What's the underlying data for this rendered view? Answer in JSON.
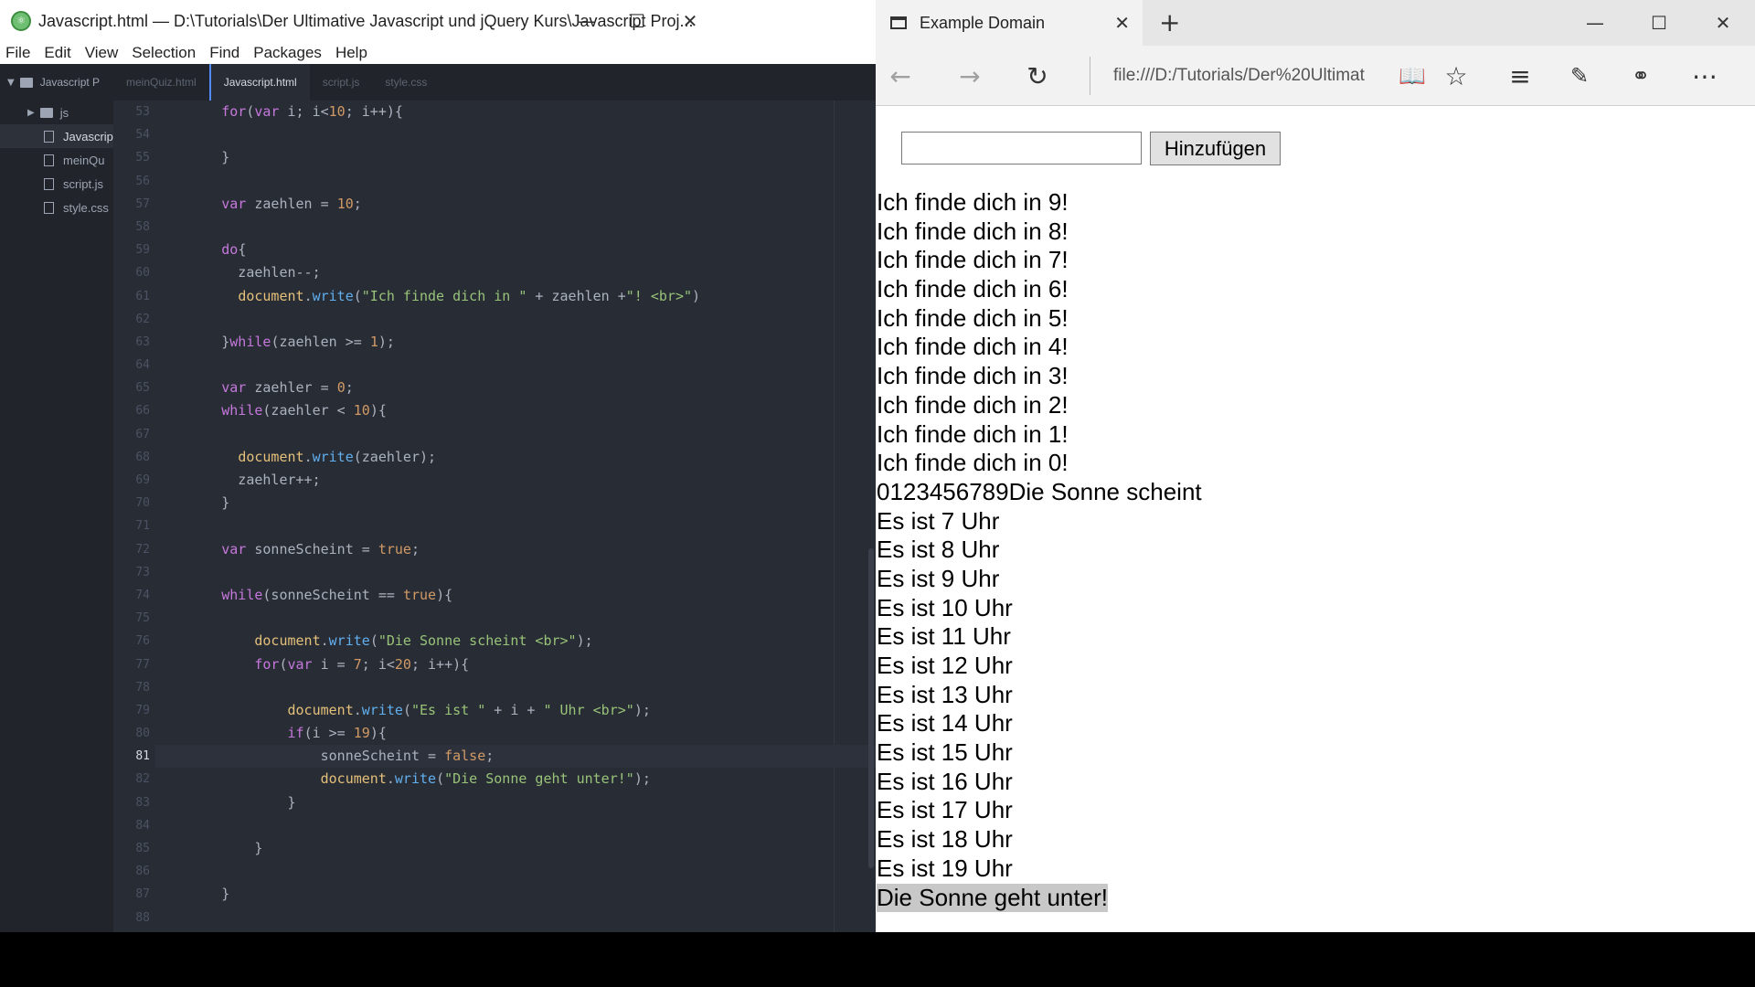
{
  "editor": {
    "title": "Javascript.html — D:\\Tutorials\\Der Ultimative Javascript und jQuery Kurs\\Javascript Proj...",
    "menu": [
      "File",
      "Edit",
      "View",
      "Selection",
      "Find",
      "Packages",
      "Help"
    ],
    "tree": {
      "root": "Javascript P",
      "items": [
        {
          "label": "js",
          "type": "folder"
        },
        {
          "label": "Javascrip",
          "type": "file"
        },
        {
          "label": "meinQu",
          "type": "file"
        },
        {
          "label": "script.js",
          "type": "file"
        },
        {
          "label": "style.css",
          "type": "file"
        }
      ]
    },
    "tabs": [
      "meinQuiz.html",
      "Javascript.html",
      "script.js",
      "style.css"
    ],
    "active_tab": "Javascript.html",
    "current_line": 81,
    "line_numbers": [
      "53",
      "54",
      "55",
      "56",
      "57",
      "58",
      "59",
      "60",
      "61",
      "62",
      "63",
      "64",
      "65",
      "66",
      "67",
      "68",
      "69",
      "70",
      "71",
      "72",
      "73",
      "74",
      "75",
      "76",
      "77",
      "78",
      "79",
      "80",
      "81",
      "82",
      "83",
      "84",
      "85",
      "86",
      "87",
      "88"
    ],
    "code_lines": [
      "        for(var i; i<10; i++){",
      "",
      "        }",
      "",
      "        var zaehlen = 10;",
      "",
      "        do{",
      "          zaehlen--;",
      "          document.write(\"Ich finde dich in \" + zaehlen +\"! <br>\")",
      "",
      "        }while(zaehlen >= 1);",
      "",
      "        var zaehler = 0;",
      "        while(zaehler < 10){",
      "",
      "          document.write(zaehler);",
      "          zaehler++;",
      "        }",
      "",
      "        var sonneScheint = true;",
      "",
      "        while(sonneScheint == true){",
      "",
      "            document.write(\"Die Sonne scheint <br>\");",
      "            for(var i = 7; i<20; i++){",
      "",
      "                document.write(\"Es ist \" + i + \" Uhr <br>\");",
      "                if(i >= 19){",
      "                    sonneScheint = false;",
      "                    document.write(\"Die Sonne geht unter!\");",
      "                }",
      "",
      "            }",
      "",
      "        }",
      ""
    ]
  },
  "browser": {
    "tab_title": "Example Domain",
    "address": "file:///D:/Tutorials/Der%20Ultimat",
    "input_value": "",
    "button_label": "Hinzufügen",
    "output_lines": [
      "Ich finde dich in 9!",
      "Ich finde dich in 8!",
      "Ich finde dich in 7!",
      "Ich finde dich in 6!",
      "Ich finde dich in 5!",
      "Ich finde dich in 4!",
      "Ich finde dich in 3!",
      "Ich finde dich in 2!",
      "Ich finde dich in 1!",
      "Ich finde dich in 0!",
      "0123456789Die Sonne scheint",
      "Es ist 7 Uhr",
      "Es ist 8 Uhr",
      "Es ist 9 Uhr",
      "Es ist 10 Uhr",
      "Es ist 11 Uhr",
      "Es ist 12 Uhr",
      "Es ist 13 Uhr",
      "Es ist 14 Uhr",
      "Es ist 15 Uhr",
      "Es ist 16 Uhr",
      "Es ist 17 Uhr",
      "Es ist 18 Uhr",
      "Es ist 19 Uhr",
      "Die Sonne geht unter!"
    ],
    "selected_line_index": 24
  },
  "icons": {
    "editor_logo": "atom-logo-icon",
    "window_minimize": "minimize-icon",
    "window_maximize": "maximize-icon",
    "window_close": "close-icon",
    "back": "back-arrow-icon",
    "forward": "forward-arrow-icon",
    "refresh": "refresh-icon",
    "reading_view": "reading-view-icon",
    "favorite": "star-icon",
    "hub": "hub-icon",
    "web_note": "web-note-icon",
    "share": "share-icon",
    "more": "more-icon"
  },
  "colors": {
    "editor_bg": "#282c34",
    "tree_bg": "#21252b",
    "keyword": "#c678dd",
    "number": "#d19a66",
    "string": "#98c379",
    "function": "#61afef",
    "selection_bg": "#c8c8c8"
  }
}
